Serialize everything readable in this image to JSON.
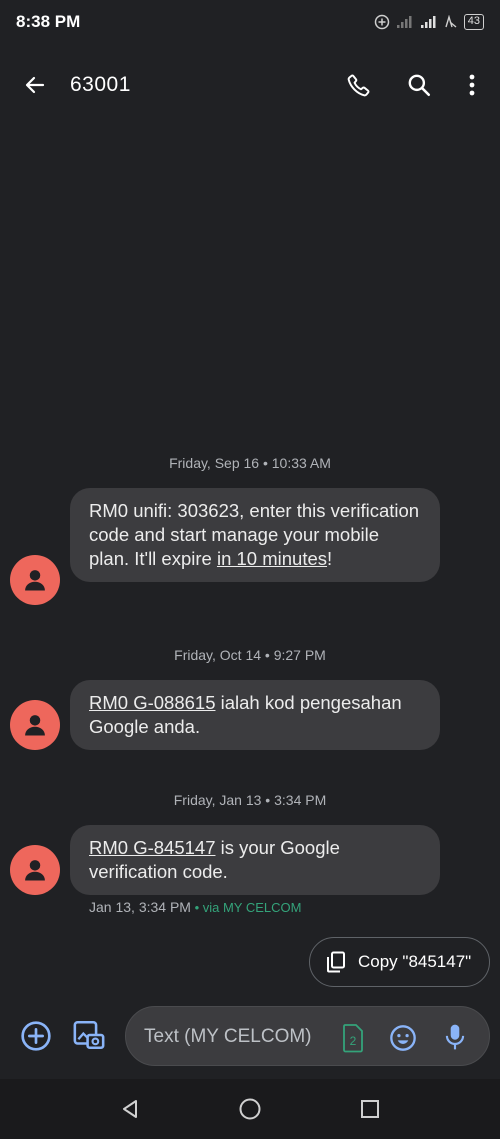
{
  "status_bar": {
    "time": "8:38 PM",
    "battery": "43",
    "icons": [
      "data-saver-icon",
      "signal-icon",
      "signal-icon",
      "volte-icon",
      "battery-icon"
    ]
  },
  "header": {
    "title": "63001",
    "icons": [
      "back-arrow-icon",
      "phone-icon",
      "search-icon",
      "more-vert-icon"
    ]
  },
  "conversation": {
    "dates": [
      "Friday, Sep 16 • 10:33 AM",
      "Friday, Oct 14 • 9:27 PM",
      "Friday, Jan 13 • 3:34 PM"
    ],
    "messages": [
      {
        "text_a": "RM0 unifi: 303623, enter this verification code and start manage your mobile plan. It'll expire ",
        "link": "in 10 minutes",
        "text_b": "!"
      },
      {
        "link": "RM0 G-088615",
        "text_b": " ialah kod pengesahan Google anda."
      },
      {
        "link": "RM0 G-845147",
        "text_b": " is your Google verification code."
      }
    ],
    "last_meta": {
      "time": "Jan 13, 3:34 PM",
      "via": " • via MY CELCOM"
    }
  },
  "suggestion": {
    "copy_label": "Copy \"845147\""
  },
  "compose": {
    "placeholder": "Text (MY CELCOM)",
    "sim_number": "2"
  },
  "colors": {
    "background": "#202124",
    "bubble": "#3c3c3f",
    "avatar": "#ee675c",
    "accent_blue": "#8ab4f8",
    "sim_green": "#34a37a"
  }
}
